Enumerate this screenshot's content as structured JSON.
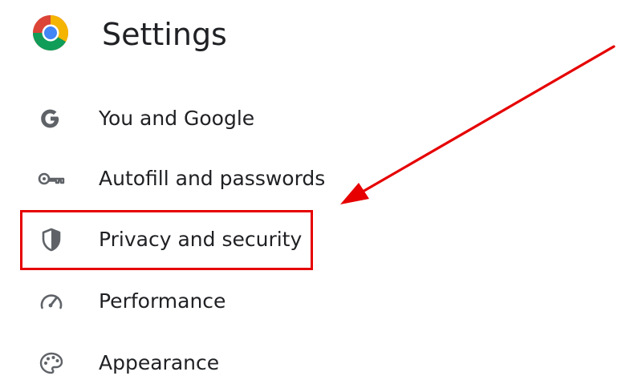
{
  "header": {
    "title": "Settings",
    "logo_icon": "chrome-logo-icon"
  },
  "menu": {
    "items": [
      {
        "label": "You and Google",
        "icon": "google-g-icon"
      },
      {
        "label": "Autofill and passwords",
        "icon": "key-icon"
      },
      {
        "label": "Privacy and security",
        "icon": "shield-icon",
        "highlighted": true
      },
      {
        "label": "Performance",
        "icon": "speedometer-icon"
      },
      {
        "label": "Appearance",
        "icon": "palette-icon"
      }
    ]
  },
  "annotation": {
    "highlight_color": "#e60000",
    "arrow_color": "#e60000"
  }
}
